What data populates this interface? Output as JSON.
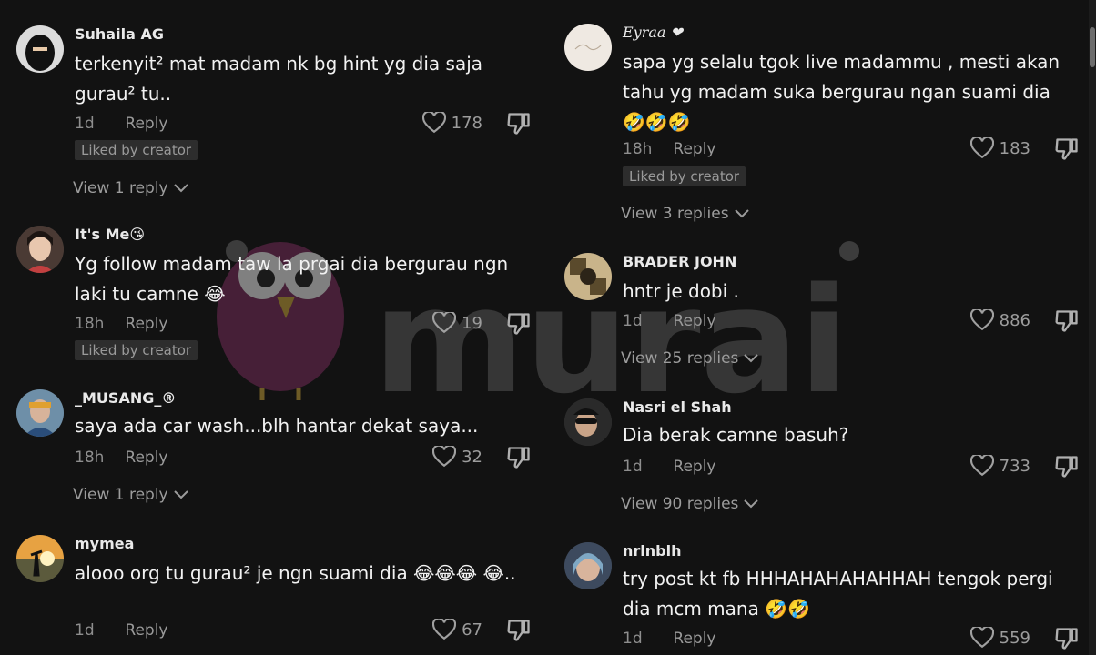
{
  "accent": "#fe2c55",
  "watermark_text": "murai",
  "left_comments": [
    {
      "username": "Suhaila AG",
      "text": "terkenyit² mat madam nk bg hint yg dia saja gurau² tu..",
      "time": "1d",
      "reply_label": "Reply",
      "likes": "178",
      "badge": "Liked by creator",
      "view_replies": "View 1 reply"
    },
    {
      "username": "It's Me😘",
      "text": "Yg follow madam taw la prgai dia bergurau ngn laki tu camne 😂",
      "time": "18h",
      "reply_label": "Reply",
      "likes": "19",
      "badge": "Liked by creator"
    },
    {
      "username": "_MUSANG_®",
      "text": "saya ada car wash...blh hantar dekat saya...",
      "time": "18h",
      "reply_label": "Reply",
      "likes": "32",
      "view_replies": "View 1 reply"
    },
    {
      "username": "mymea",
      "text": "alooo org tu gurau² je ngn suami dia 😂😂😂 😂..",
      "time": "1d",
      "reply_label": "Reply",
      "likes": "67"
    }
  ],
  "right_comments": [
    {
      "username": "Eyraa ❤",
      "text": "sapa yg selalu tgok live madammu , mesti akan tahu yg madam suka bergurau ngan suami dia 🤣🤣🤣",
      "time": "18h",
      "reply_label": "Reply",
      "likes": "183",
      "badge": "Liked by creator",
      "view_replies": "View 3 replies"
    },
    {
      "username": "BRADER JOHN",
      "text": "hntr je dobi .",
      "time": "1d",
      "reply_label": "Reply",
      "likes": "886",
      "view_replies": "View 25 replies"
    },
    {
      "username": "Nasri el Shah",
      "text": "Dia berak camne basuh?",
      "time": "1d",
      "reply_label": "Reply",
      "likes": "733",
      "view_replies": "View 90 replies"
    },
    {
      "username": "nrlnblh",
      "text": "try post kt fb HHHAHAHAHAHHAH tengok pergi dia mcm mana 🤣🤣",
      "time": "1d",
      "reply_label": "Reply",
      "likes": "559"
    }
  ],
  "icons": {
    "like": "heart-outline-icon",
    "dislike": "thumbs-down-icon",
    "expand": "chevron-down-icon"
  }
}
